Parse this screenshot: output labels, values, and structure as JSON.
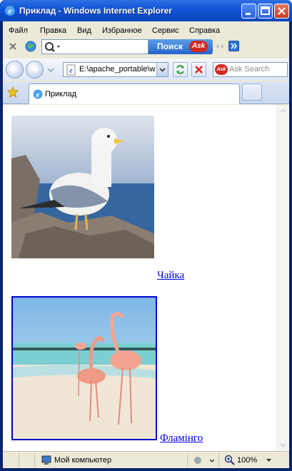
{
  "window": {
    "title": "Приклад - Windows Internet Explorer"
  },
  "menu": {
    "items": [
      {
        "label": "Файл"
      },
      {
        "label": "Правка"
      },
      {
        "label": "Вид"
      },
      {
        "label": "Избранное"
      },
      {
        "label": "Сервис"
      },
      {
        "label": "Справка"
      }
    ]
  },
  "toolbar": {
    "search_button_label": "Поиск",
    "ask_logo": "Ask"
  },
  "address_bar": {
    "url": "E:\\apache_portable\\w",
    "ask_search_placeholder": "Ask Search"
  },
  "tabs": [
    {
      "label": "Приклад"
    }
  ],
  "content": {
    "images": [
      {
        "alt": "seagull-photo",
        "link_text": "Чайка"
      },
      {
        "alt": "flamingo-photo",
        "link_text": "Фламінго"
      }
    ]
  },
  "status_bar": {
    "zone": "Мой компьютер",
    "zoom": "100%"
  },
  "colors": {
    "link": "#0000ee",
    "titlebar": "#1156d8",
    "chrome": "#ece9d8"
  }
}
